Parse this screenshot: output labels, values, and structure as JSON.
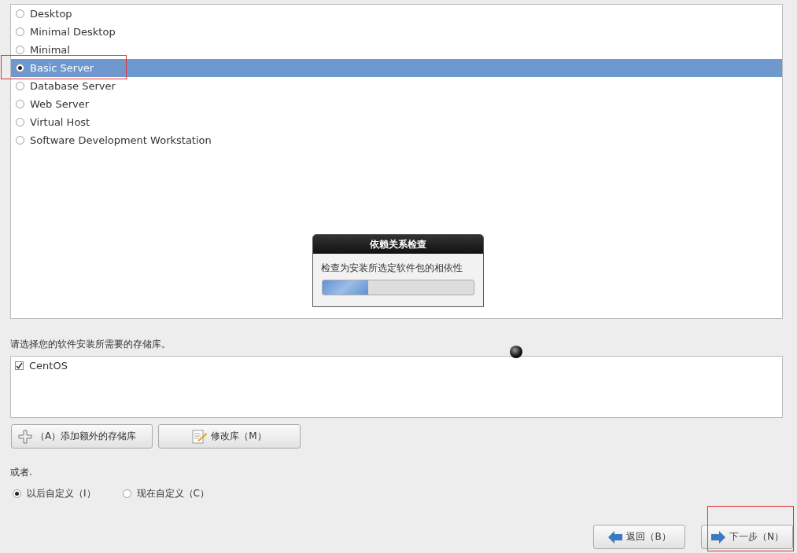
{
  "install_types": [
    {
      "label": "Desktop",
      "selected": false
    },
    {
      "label": "Minimal Desktop",
      "selected": false
    },
    {
      "label": "Minimal",
      "selected": false
    },
    {
      "label": "Basic Server",
      "selected": true
    },
    {
      "label": "Database Server",
      "selected": false
    },
    {
      "label": "Web Server",
      "selected": false
    },
    {
      "label": "Virtual Host",
      "selected": false
    },
    {
      "label": "Software Development Workstation",
      "selected": false
    }
  ],
  "progress_dialog": {
    "title": "依赖关系检查",
    "message": "检查为安装所选定软件包的相依性",
    "level": 0.3
  },
  "repo_prompt": "请选择您的软件安装所需要的存储库。",
  "repositories": [
    {
      "label": "CentOS",
      "checked": true
    }
  ],
  "repo_buttons": [
    {
      "kind": "add",
      "label": "（A）添加额外的存储库"
    },
    {
      "kind": "modify",
      "label": "修改库（M）"
    }
  ],
  "or_label": "或者.",
  "customize_options": [
    {
      "label": "以后自定义（I）",
      "selected": true
    },
    {
      "label": "现在自定义（C）",
      "selected": false
    }
  ],
  "nav_buttons": [
    {
      "kind": "back",
      "label": "返回（B）"
    },
    {
      "kind": "next",
      "label": "下一步（N）"
    }
  ]
}
